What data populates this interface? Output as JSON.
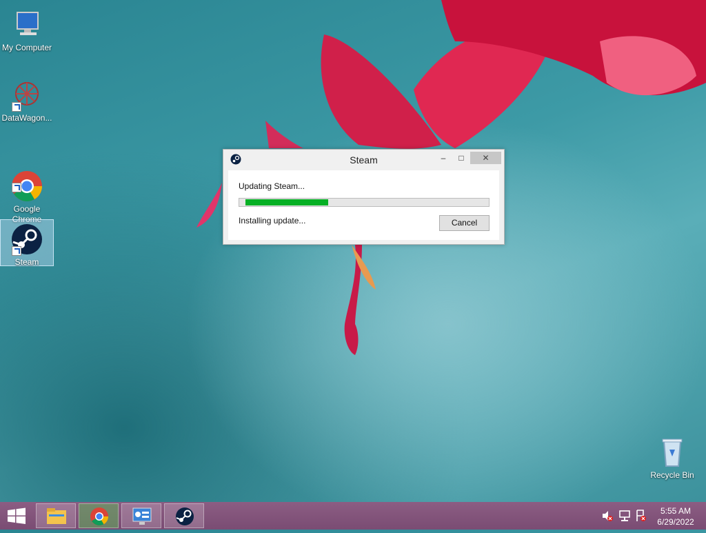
{
  "desktop": {
    "icons": [
      {
        "label": "My Computer"
      },
      {
        "label": "DataWagon..."
      },
      {
        "label": "Google\nChrome"
      },
      {
        "label": "Steam"
      },
      {
        "label": "Recycle Bin"
      }
    ]
  },
  "dialog": {
    "title": "Steam",
    "status_line": "Updating Steam...",
    "progress_fraction": 0.35,
    "detail_line": "Installing update...",
    "cancel_label": "Cancel",
    "minimize_glyph": "–",
    "maximize_glyph": "□",
    "close_glyph": "✕"
  },
  "taskbar": {
    "pinned": [
      "file-explorer-icon",
      "chrome-icon",
      "control-panel-icon",
      "steam-icon"
    ],
    "tray_icons": [
      "volume-muted-icon",
      "network-icon",
      "action-center-icon"
    ],
    "clock": {
      "time": "5:55 AM",
      "date": "6/29/2022"
    }
  }
}
